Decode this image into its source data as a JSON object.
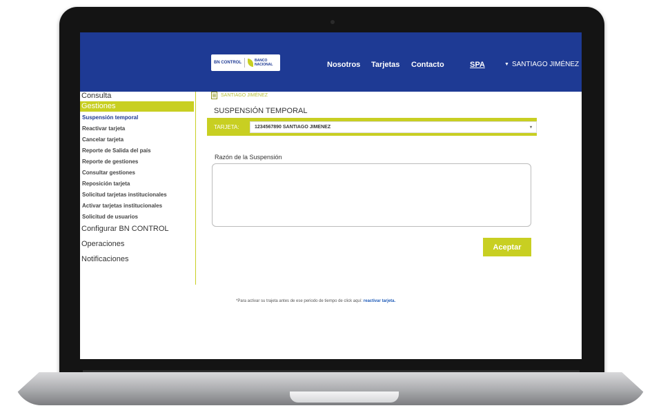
{
  "header": {
    "logo_text": "BN CONTROL",
    "bank_name_line1": "BANCO",
    "bank_name_line2": "NACIONAL",
    "nav": [
      "Nosotros",
      "Tarjetas",
      "Contacto",
      "SPA"
    ],
    "user_name": "SANTIAGO JIMÉNEZ"
  },
  "sidebar": {
    "consulta": "Consulta",
    "gestiones": "Gestiones",
    "gestiones_items": [
      "Suspensión temporal",
      "Reactivar tarjeta",
      "Cancelar tarjeta",
      "Reporte de Salida del país",
      "Reporte de gestiones",
      "Consultar gestiones",
      "Reposición tarjeta",
      "Solicitud tarjetas institucionales",
      "Activar tarjetas institucionales",
      "Solicitud de usuarios"
    ],
    "configurar": "Configurar BN CONTROL",
    "operaciones": "Operaciones",
    "notificaciones": "Notificaciones"
  },
  "main": {
    "breadcrumb": "SANTIAGO JIMÉNEZ",
    "title": "SUSPENSIÓN TEMPORAL",
    "card_label": "TARJETA:",
    "card_value": "1234567890 SANTIAGO JIMENEZ",
    "reason_label": "Razón de la Suspensión",
    "reason_value": "",
    "accept_label": "Aceptar"
  },
  "footer": {
    "note": "*Para activar su trajeta antes de ese periodo de tiempo de click aquí: ",
    "link": "reactivar tarjeta."
  },
  "colors": {
    "header_blue": "#1e3a94",
    "accent_lime": "#c8cf22"
  }
}
